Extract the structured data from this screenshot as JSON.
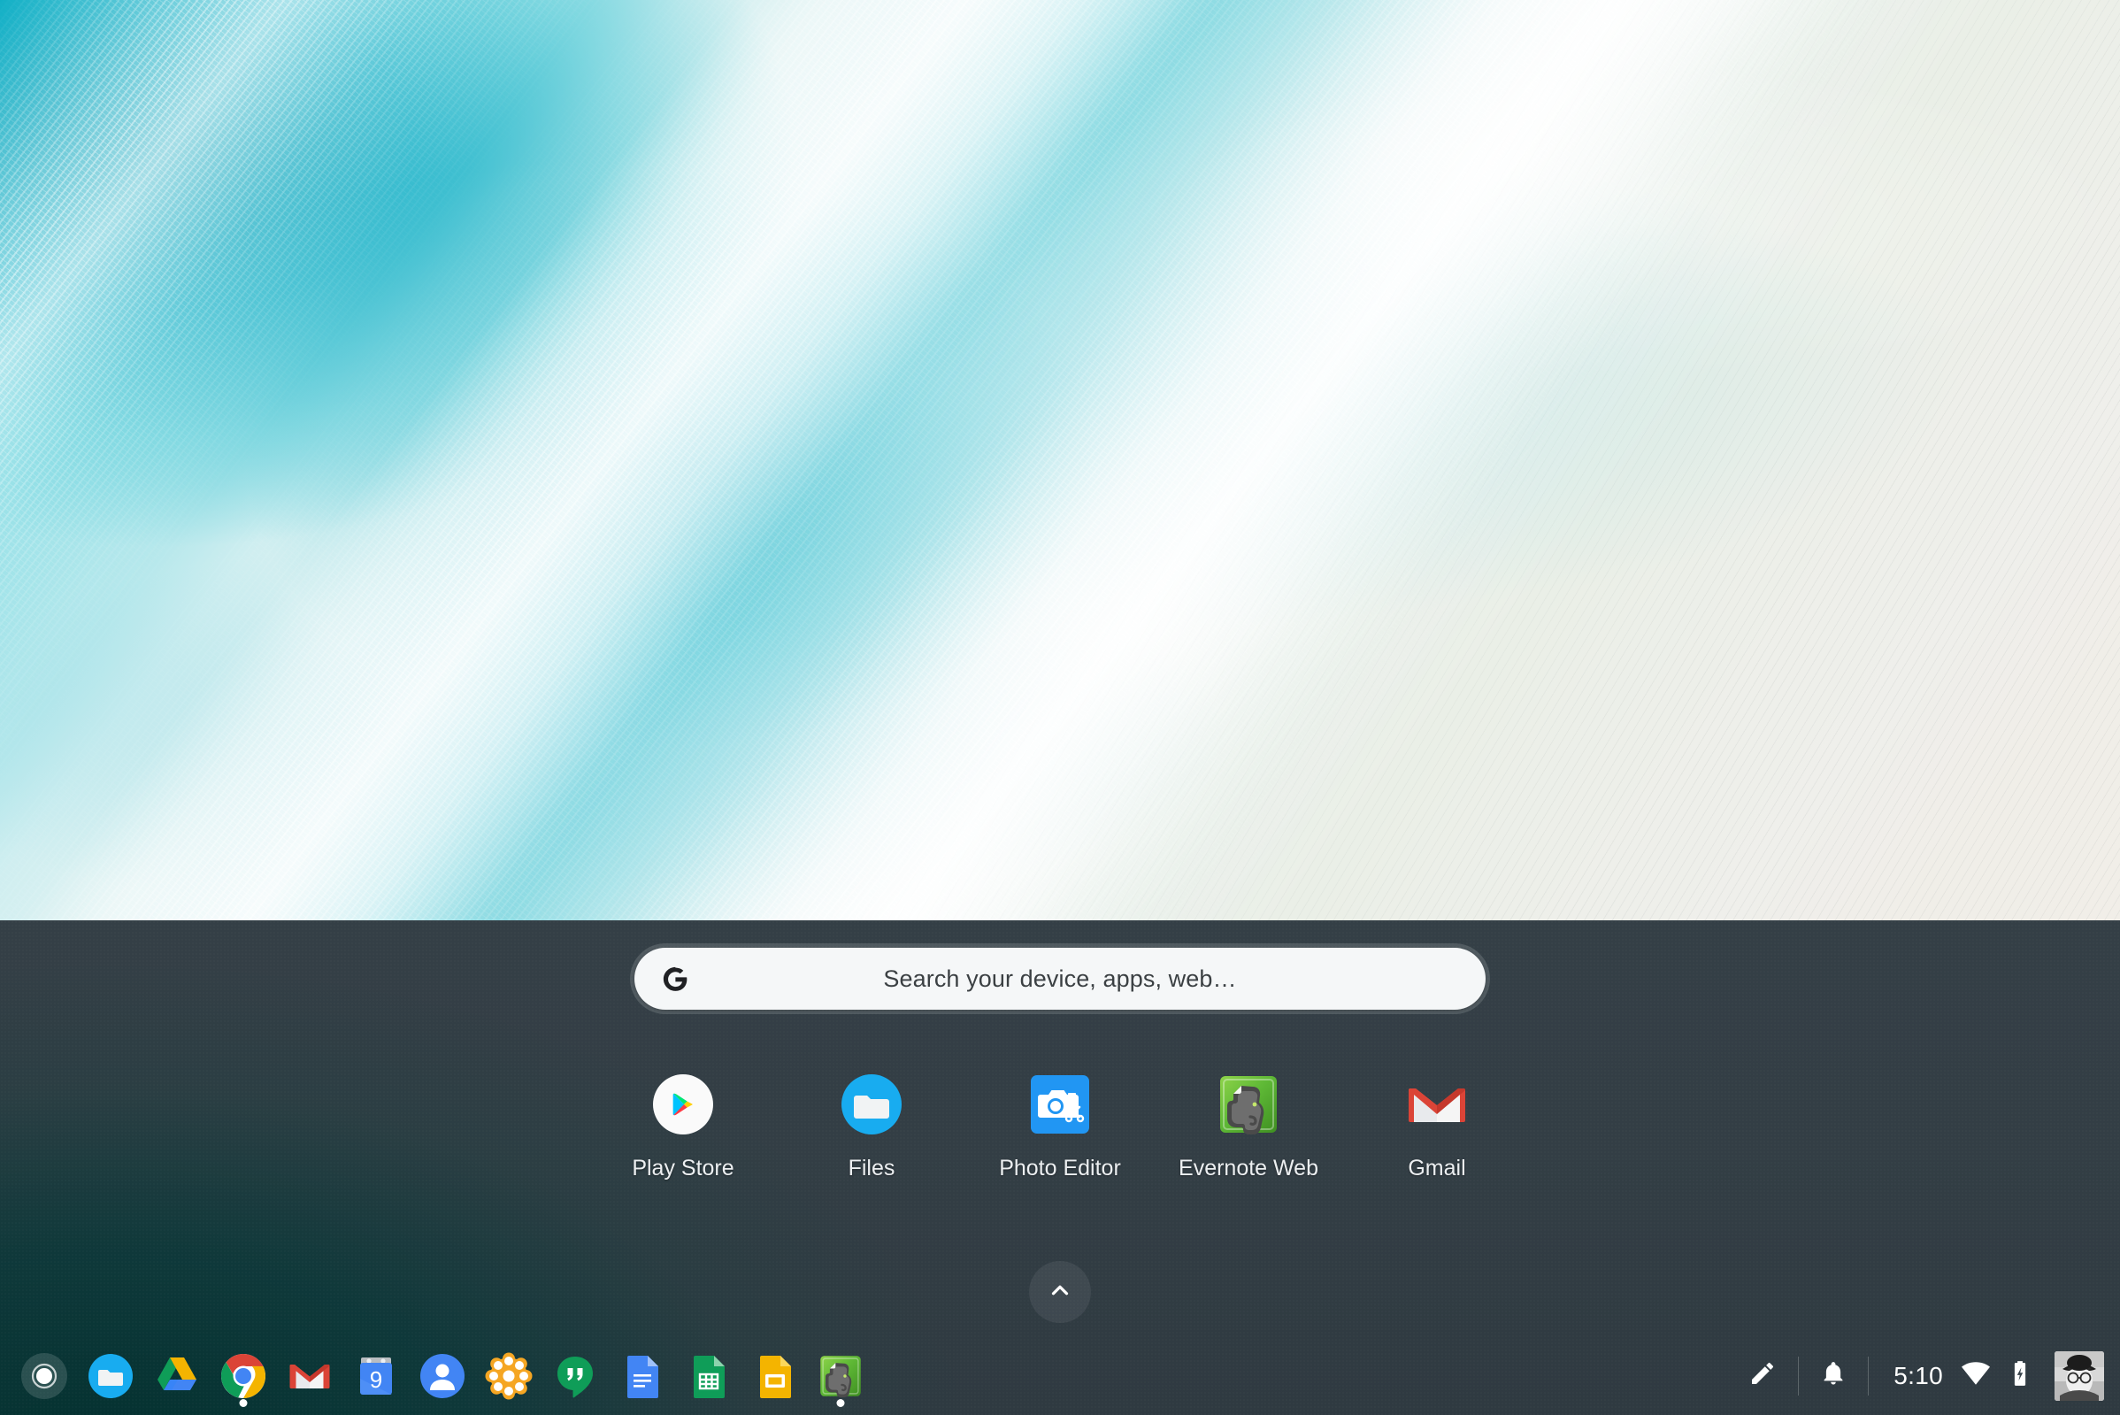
{
  "desktop": {
    "wallpaper_description": "aerial-ocean-beach-turquoise-surf"
  },
  "launcher": {
    "search": {
      "placeholder": "Search your device, apps, web…",
      "icon": "google-g-icon"
    },
    "apps": [
      {
        "label": "Play Store",
        "icon": "play-store-icon"
      },
      {
        "label": "Files",
        "icon": "files-folder-icon"
      },
      {
        "label": "Photo Editor",
        "icon": "photo-editor-camera-icon"
      },
      {
        "label": "Evernote Web",
        "icon": "evernote-elephant-icon"
      },
      {
        "label": "Gmail",
        "icon": "gmail-envelope-icon"
      }
    ],
    "expand": {
      "icon": "chevron-up-icon",
      "tooltip": "Show all apps"
    }
  },
  "shelf": {
    "launcher_button": {
      "label": "Launcher",
      "icon": "launcher-circle-icon"
    },
    "items": [
      {
        "label": "Files",
        "icon": "files-folder-icon",
        "active": false
      },
      {
        "label": "Google Drive",
        "icon": "google-drive-icon",
        "active": false
      },
      {
        "label": "Chrome",
        "icon": "chrome-icon",
        "active": true
      },
      {
        "label": "Gmail",
        "icon": "gmail-envelope-icon",
        "active": false
      },
      {
        "label": "Calendar",
        "icon": "calendar-icon",
        "active": false,
        "day": "9"
      },
      {
        "label": "Contacts",
        "icon": "contacts-person-icon",
        "active": false
      },
      {
        "label": "Photos",
        "icon": "photos-flower-icon",
        "active": false
      },
      {
        "label": "Hangouts",
        "icon": "hangouts-icon",
        "active": false
      },
      {
        "label": "Google Docs",
        "icon": "docs-icon",
        "active": false
      },
      {
        "label": "Google Sheets",
        "icon": "sheets-icon",
        "active": false
      },
      {
        "label": "Google Slides",
        "icon": "slides-icon",
        "active": false
      },
      {
        "label": "Evernote",
        "icon": "evernote-elephant-icon",
        "active": true
      }
    ],
    "tray": {
      "stylus": {
        "label": "Stylus tools",
        "icon": "stylus-pen-icon"
      },
      "notifications": {
        "label": "Notifications",
        "icon": "bell-icon"
      },
      "time": "5:10",
      "network": {
        "label": "Wi-Fi",
        "icon": "wifi-icon"
      },
      "battery": {
        "label": "Battery charging",
        "icon": "battery-charging-icon"
      },
      "avatar": {
        "label": "User account",
        "icon": "avatar-photo"
      }
    }
  },
  "colors": {
    "panel_bg": "#333e45",
    "panel_tint": "#00302e",
    "search_bg": "#f5f7f8",
    "search_text": "#3b4043",
    "app_label": "#eceff1",
    "accent_blue": "#2196f3",
    "chrome_red": "#db4437",
    "chrome_yellow": "#f4b400",
    "chrome_green": "#0f9d58",
    "chrome_blue": "#4285f4",
    "evernote_green": "#5fb936",
    "gmail_red": "#d93025"
  }
}
